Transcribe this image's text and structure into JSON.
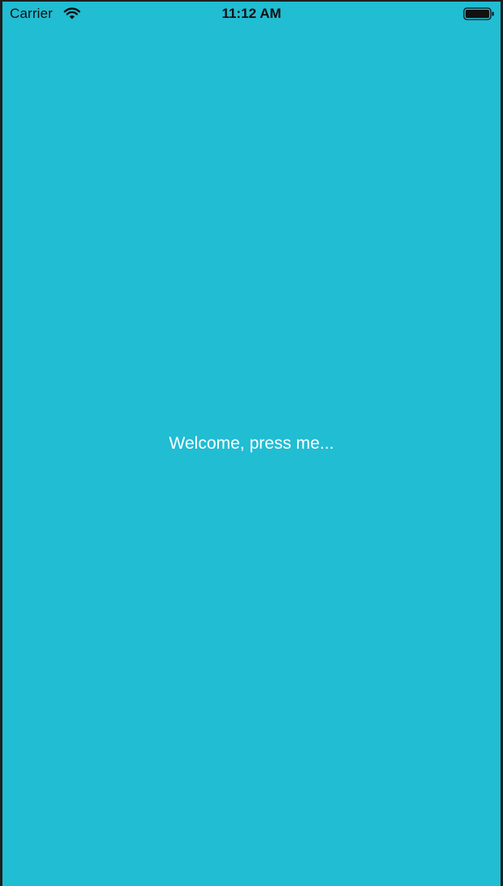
{
  "status_bar": {
    "carrier": "Carrier",
    "time": "11:12 AM",
    "wifi_icon": "wifi-icon",
    "battery_icon": "battery-icon"
  },
  "main": {
    "welcome_text": "Welcome, press me..."
  },
  "colors": {
    "background": "#20bdd3",
    "text": "#ffffff",
    "status_text": "#111111"
  }
}
